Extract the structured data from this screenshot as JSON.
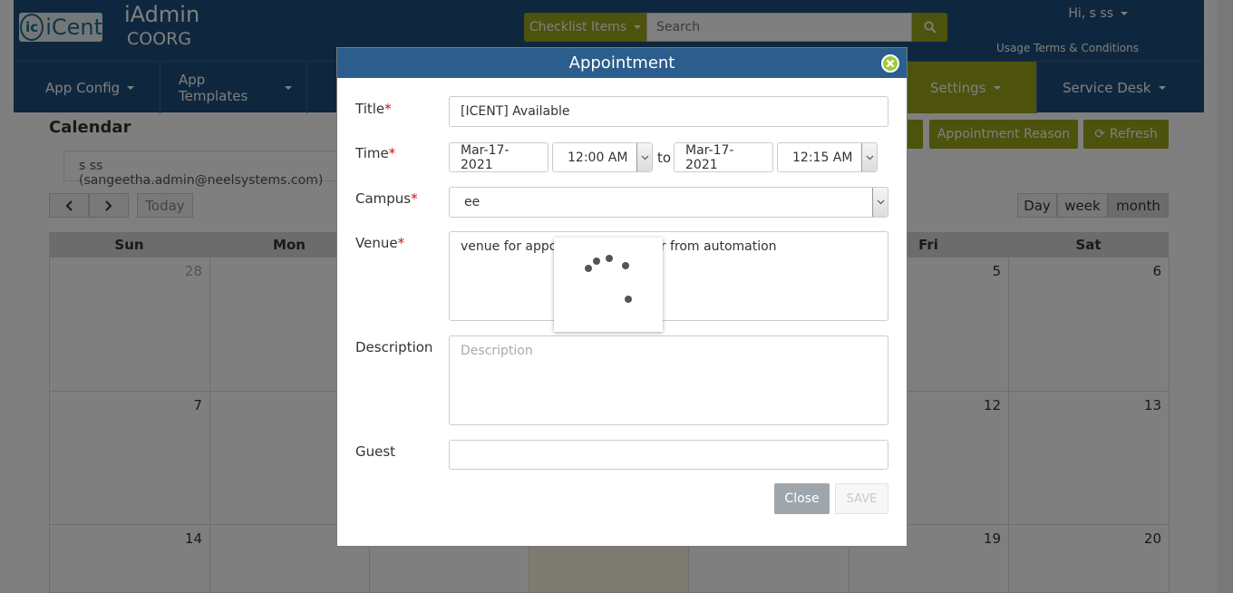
{
  "header": {
    "logo_mark": "ic",
    "logo_text": "iCent",
    "app_name": "iAdmin",
    "org_name": "COORG",
    "checklist_label": "Checklist Items",
    "search_placeholder": "Search",
    "user_greeting": "Hi, s ss",
    "terms_link": "Usage Terms & Conditions"
  },
  "nav": {
    "items": [
      {
        "label": "App Config"
      },
      {
        "label": "App Templates"
      },
      {
        "label": "Settings"
      },
      {
        "label": "Service Desk"
      }
    ]
  },
  "page": {
    "title": "Calendar",
    "user_select": "s ss (sangeetha.admin@neelsystems.com)",
    "appointment_reason_btn": "Appointment Reason",
    "refresh_btn": "Refresh",
    "prev_icon": "chevron-left-icon",
    "next_icon": "chevron-right-icon",
    "today_btn": "Today",
    "views": [
      "Day",
      "week",
      "month"
    ],
    "active_view": "month",
    "day_names": [
      "Sun",
      "Mon",
      "Fri",
      "Sat"
    ],
    "week1": {
      "sun": "28",
      "fri": "5",
      "sat": "6"
    },
    "week2": {
      "sun": "7",
      "fri": "12",
      "sat": "13"
    },
    "week3": {
      "sun": "14",
      "fri": "19",
      "sat": "20"
    }
  },
  "modal": {
    "title": "Appointment",
    "close_icon": "close-circle-icon",
    "title_label": "Title",
    "title_value": "[ICENT] Available",
    "time_label": "Time",
    "start_date": "Mar-17-2021",
    "start_time": "12:00 AM",
    "to_label": "to",
    "end_date": "Mar-17-2021",
    "end_time": "12:15 AM",
    "campus_label": "Campus",
    "campus_value": "ee",
    "venue_label": "Venue",
    "venue_value": "venue for appointment calendar from automation",
    "description_label": "Description",
    "description_placeholder": "Description",
    "guest_label": "Guest",
    "guest_value": "",
    "close_btn": "Close",
    "save_btn": "SAVE",
    "required_mark": "*"
  },
  "colors": {
    "brand_blue": "#1f4f7c",
    "accent_olive": "#9aa51a",
    "modal_header": "#2b5d8d",
    "close_icon_green": "#9fcc3b"
  }
}
